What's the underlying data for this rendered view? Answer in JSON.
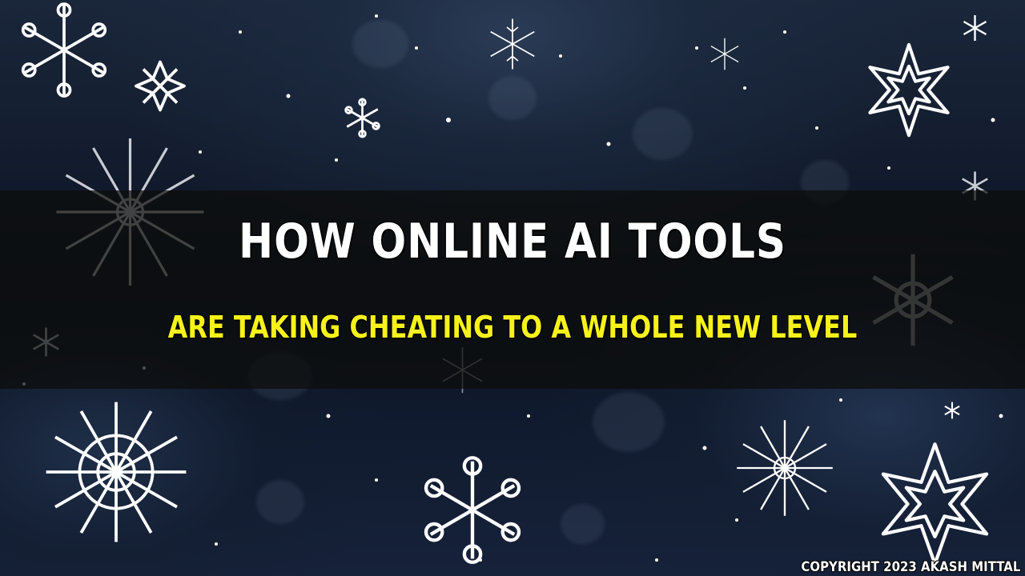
{
  "thumbnail": {
    "title": "HOW ONLINE AI TOOLS",
    "subtitle": "ARE TAKING CHEATING TO A WHOLE NEW LEVEL",
    "copyright": "COPYRIGHT 2023 AKASH MITTAL"
  },
  "background": {
    "theme": "snowflakes-icon",
    "base_color": "#0b1220",
    "banner_color": "#0c0c0a",
    "title_color": "#ffffff",
    "subtitle_color": "#f6f21a"
  }
}
